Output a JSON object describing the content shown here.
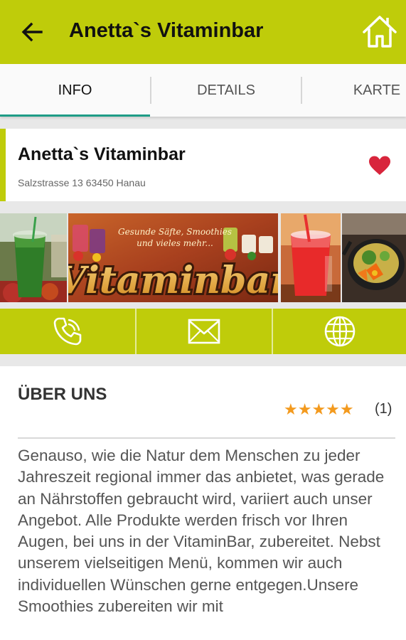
{
  "header": {
    "title": "Anetta`s Vitaminbar",
    "back_icon": "arrow-left-icon",
    "home_icon": "home-icon",
    "color": "#bfcc0a"
  },
  "tabs": [
    {
      "label": "INFO",
      "active": true
    },
    {
      "label": "DETAILS",
      "active": false
    },
    {
      "label": "KARTE",
      "active": false
    }
  ],
  "business": {
    "name": "Anetta`s Vitaminbar",
    "address": "Salzstrasse 13 63450 Hanau",
    "favorite": true,
    "favorite_color": "#d8253c"
  },
  "gallery": {
    "banner_tagline_1": "Gesunde Säfte, Smoothies",
    "banner_tagline_2": "und vieles mehr...",
    "banner_logo": "Vitaminbar"
  },
  "actions": [
    {
      "icon": "phone-icon"
    },
    {
      "icon": "mail-icon"
    },
    {
      "icon": "globe-icon"
    }
  ],
  "about": {
    "title": "ÜBER UNS",
    "rating": 5,
    "stars": "★★★★★",
    "rating_count": "(1)",
    "text": "Genauso, wie die Natur dem Menschen zu jeder Jahreszeit regional immer das anbietet, was gerade an Nährstoffen gebraucht wird, variiert auch unser Angebot. Alle Produkte werden frisch vor Ihren Augen, bei uns in der VitaminBar, zubereitet. Nebst unserem vielseitigen Menü, kommen wir auch individuellen Wünschen gerne entgegen.Unsere Smoothies zubereiten wir mit"
  }
}
